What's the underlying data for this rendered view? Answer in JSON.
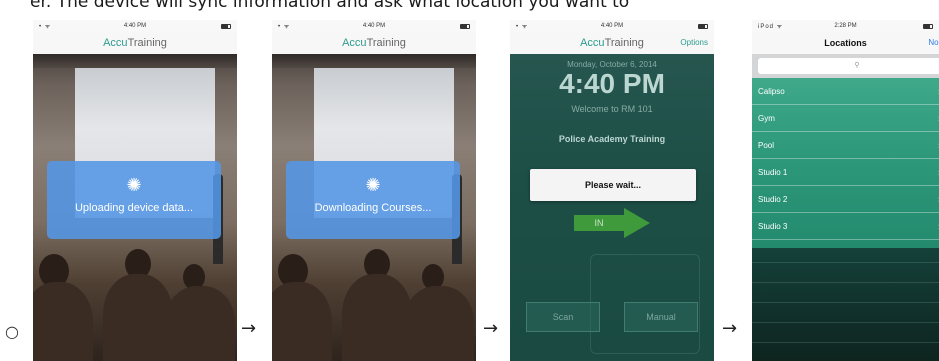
{
  "caption": "er. The device will sync information and ask what location you want to",
  "bullet": "○",
  "arrow": "→",
  "screens": [
    {
      "status": {
        "signal": "• ᯤ",
        "time": "4:40 PM",
        "battery": "battery-icon"
      },
      "app_title_accent": "Accu",
      "app_title_rest": "Training",
      "overlay_message": "Uploading device data...",
      "spinner": "spinner-icon"
    },
    {
      "status": {
        "signal": "• ᯤ",
        "time": "4:40 PM",
        "battery": "battery-icon"
      },
      "app_title_accent": "Accu",
      "app_title_rest": "Training",
      "overlay_message": "Downloading Courses...",
      "spinner": "spinner-icon"
    },
    {
      "status": {
        "signal": "• ᯤ",
        "time": "4:40 PM",
        "battery": "battery-icon"
      },
      "app_title_accent": "Accu",
      "app_title_rest": "Training",
      "options_label": "Options",
      "date": "Monday, October 6, 2014",
      "clock": "4:40 PM",
      "welcome": "Welcome to RM 101",
      "course": "Police Academy Training",
      "wait_message": "Please wait...",
      "in_label": "IN",
      "scan_label": "Scan",
      "manual_label": "Manual"
    },
    {
      "status": {
        "signal": "iPod ᯤ",
        "time": "2:28 PM",
        "battery": "battery-icon"
      },
      "nav_title": "Locations",
      "nav_right": "Non",
      "search_icon": "search-icon",
      "locations": [
        "Calipso",
        "Gym",
        "Pool",
        "Studio 1",
        "Studio 2",
        "Studio 3"
      ]
    }
  ],
  "colors": {
    "brand_teal": "#2e9b8f",
    "overlay_blue": "#5496e6",
    "in_green": "#3f9a3b",
    "list_green": "#2f9a7c"
  }
}
